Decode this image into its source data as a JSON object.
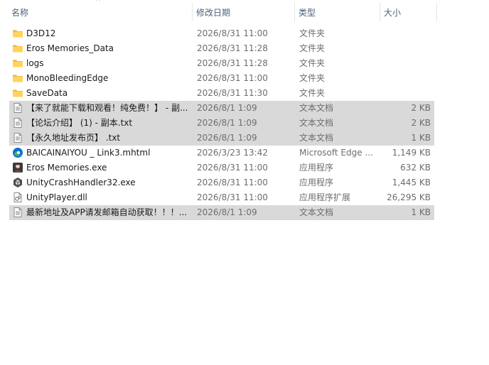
{
  "columns": {
    "name": "名称",
    "date": "修改日期",
    "type": "类型",
    "size": "大小",
    "sort_glyph": "^"
  },
  "colors": {
    "header_text": "#4c607a",
    "selection": "#d9d9d9",
    "folder": "#ffd35c",
    "folder_dark": "#e8b339",
    "edge_blue": "#0c6fd1",
    "edge_green": "#3fbf5a"
  },
  "files": [
    {
      "name": "D3D12",
      "date": "2026/8/31 11:00",
      "type": "文件夹",
      "size": "",
      "icon": "folder-icon",
      "selected": false
    },
    {
      "name": "Eros Memories_Data",
      "date": "2026/8/31 11:28",
      "type": "文件夹",
      "size": "",
      "icon": "folder-icon",
      "selected": false
    },
    {
      "name": "logs",
      "date": "2026/8/31 11:28",
      "type": "文件夹",
      "size": "",
      "icon": "folder-icon",
      "selected": false
    },
    {
      "name": "MonoBleedingEdge",
      "date": "2026/8/31 11:00",
      "type": "文件夹",
      "size": "",
      "icon": "folder-icon",
      "selected": false
    },
    {
      "name": "SaveData",
      "date": "2026/8/31 11:30",
      "type": "文件夹",
      "size": "",
      "icon": "folder-icon",
      "selected": false
    },
    {
      "name": "【来了就能下载和观看！纯免费！】 - 副...",
      "date": "2026/8/1 1:09",
      "type": "文本文档",
      "size": "2 KB",
      "icon": "text-document-icon",
      "selected": true
    },
    {
      "name": "【论坛介绍】 (1) - 副本.txt",
      "date": "2026/8/1 1:09",
      "type": "文本文档",
      "size": "2 KB",
      "icon": "text-document-icon",
      "selected": true
    },
    {
      "name": "【永久地址发布页】 .txt",
      "date": "2026/8/1 1:09",
      "type": "文本文档",
      "size": "1 KB",
      "icon": "text-document-icon",
      "selected": true
    },
    {
      "name": "BAICAINAIYOU _ Link3.mhtml",
      "date": "2026/3/23 13:42",
      "type": "Microsoft Edge ...",
      "size": "1,149 KB",
      "icon": "edge-icon",
      "selected": false
    },
    {
      "name": "Eros Memories.exe",
      "date": "2026/8/31 11:00",
      "type": "应用程序",
      "size": "632 KB",
      "icon": "game-app-icon",
      "selected": false
    },
    {
      "name": "UnityCrashHandler32.exe",
      "date": "2026/8/31 11:00",
      "type": "应用程序",
      "size": "1,445 KB",
      "icon": "unity-icon",
      "selected": false
    },
    {
      "name": "UnityPlayer.dll",
      "date": "2026/8/31 11:00",
      "type": "应用程序扩展",
      "size": "26,295 KB",
      "icon": "dll-file-icon",
      "selected": false
    },
    {
      "name": "最新地址及APP请发邮箱自动获取！！！...",
      "date": "2026/8/1 1:09",
      "type": "文本文档",
      "size": "1 KB",
      "icon": "text-document-icon",
      "selected": true
    }
  ]
}
